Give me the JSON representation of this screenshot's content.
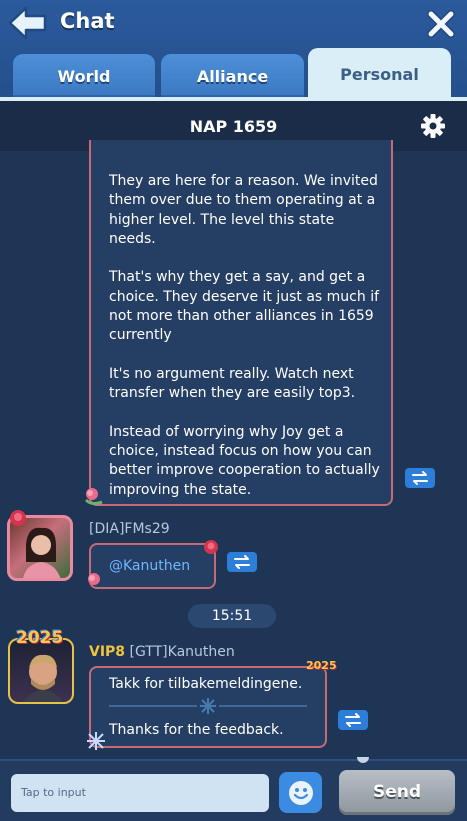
{
  "header": {
    "title": "Chat",
    "tabs": [
      {
        "label": "World",
        "active": false
      },
      {
        "label": "Alliance",
        "active": false
      },
      {
        "label": "Personal",
        "active": true
      }
    ]
  },
  "channel": {
    "title": "NAP 1659"
  },
  "messages": [
    {
      "text": "They are here for a reason. We invited them over due to them operating at a higher level. The level this state needs.\n\nThat's why they get a say, and get a choice. They deserve it just as much if not more than other alliances in 1659 currently\n\nIt's no argument really. Watch next transfer when they are easily top3.\n\nInstead of worrying why Joy get a choice, instead focus on how you can better improve cooperation to actually improving the state."
    },
    {
      "sender": "[DIA]FMs29",
      "text": "@Kanuthen"
    },
    {
      "timestamp": "15:51"
    },
    {
      "vip": "VIP8",
      "sender": "[GTT]Kanuthen",
      "badge": "2025",
      "original": "Takk for tilbakemeldingene.",
      "translation": "Thanks for the feedback."
    }
  ],
  "input": {
    "placeholder": "Tap to input",
    "send_label": "Send"
  },
  "colors": {
    "header": "#2b5a9c",
    "background": "#1f3556",
    "bubble": "#243e64",
    "bubble_border": "#c86a76",
    "mention": "#6fb7ff",
    "vip": "#f2c33c",
    "translate_button": "#2d7ed8"
  },
  "icons": [
    "back-arrow-icon",
    "close-icon",
    "gear-icon",
    "translate-icon",
    "rose-icon",
    "emoji-icon"
  ]
}
